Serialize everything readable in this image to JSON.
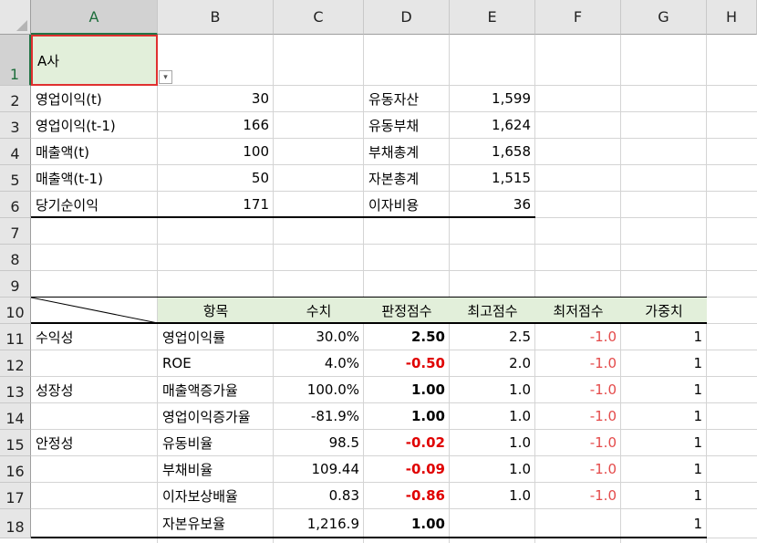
{
  "columns": [
    "A",
    "B",
    "C",
    "D",
    "E",
    "F",
    "G",
    "H"
  ],
  "rows": [
    "1",
    "2",
    "3",
    "4",
    "5",
    "6",
    "7",
    "8",
    "9",
    "10",
    "11",
    "12",
    "13",
    "14",
    "15",
    "16",
    "17",
    "18"
  ],
  "selected_cell": {
    "column": "A",
    "row": "1",
    "value": "A사"
  },
  "summary_left": [
    {
      "label": "영업이익(t)",
      "value": "30"
    },
    {
      "label": "영업이익(t-1)",
      "value": "166"
    },
    {
      "label": "매출액(t)",
      "value": "100"
    },
    {
      "label": "매출액(t-1)",
      "value": "50"
    },
    {
      "label": "당기순이익",
      "value": "171"
    }
  ],
  "summary_right": [
    {
      "label": "유동자산",
      "value": "1,599"
    },
    {
      "label": "유동부채",
      "value": "1,624"
    },
    {
      "label": "부채총계",
      "value": "1,658"
    },
    {
      "label": "자본총계",
      "value": "1,515"
    },
    {
      "label": "이자비용",
      "value": "36"
    }
  ],
  "table_headers": [
    "항목",
    "수치",
    "판정점수",
    "최고점수",
    "최저점수",
    "가중치"
  ],
  "table_rows": [
    {
      "category": "수익성",
      "item": "영업이익률",
      "value": "30.0%",
      "score": "2.50",
      "score_negative": false,
      "max": "2.5",
      "min": "-1.0",
      "weight": "1"
    },
    {
      "category": "",
      "item": "ROE",
      "value": "4.0%",
      "score": "-0.50",
      "score_negative": true,
      "max": "2.0",
      "min": "-1.0",
      "weight": "1"
    },
    {
      "category": "성장성",
      "item": "매출액증가율",
      "value": "100.0%",
      "score": "1.00",
      "score_negative": false,
      "max": "1.0",
      "min": "-1.0",
      "weight": "1"
    },
    {
      "category": "",
      "item": "영업이익증가율",
      "value": "-81.9%",
      "score": "1.00",
      "score_negative": false,
      "max": "1.0",
      "min": "-1.0",
      "weight": "1"
    },
    {
      "category": "안정성",
      "item": "유동비율",
      "value": "98.5",
      "score": "-0.02",
      "score_negative": true,
      "max": "1.0",
      "min": "-1.0",
      "weight": "1"
    },
    {
      "category": "",
      "item": "부채비율",
      "value": "109.44",
      "score": "-0.09",
      "score_negative": true,
      "max": "1.0",
      "min": "-1.0",
      "weight": "1"
    },
    {
      "category": "",
      "item": "이자보상배율",
      "value": "0.83",
      "score": "-0.86",
      "score_negative": true,
      "max": "1.0",
      "min": "-1.0",
      "weight": "1"
    },
    {
      "category": "",
      "item": "자본유보율",
      "value": "1,216.9",
      "score": "1.00",
      "score_negative": false,
      "max": "",
      "min": "",
      "weight": "1"
    }
  ],
  "colors": {
    "header_bg": "#e6e6e6",
    "header_selected_bg": "#d2d2d2",
    "accent_green": "#217346",
    "table_header_fill": "#e2efda",
    "negative_red": "#e00000",
    "selection_border": "#e03030"
  },
  "icons": {
    "dropdown": "chevron-down-icon"
  }
}
